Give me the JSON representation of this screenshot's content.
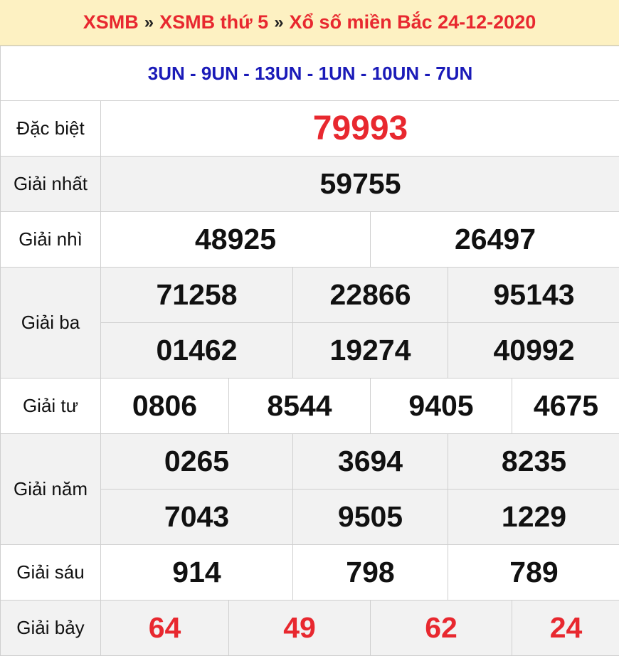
{
  "breadcrumb": {
    "item1": "XSMB",
    "sep1": "»",
    "item2": "XSMB thứ 5",
    "sep2": "»",
    "item3": "Xổ số miền Bắc 24-12-2020"
  },
  "codes": "3UN - 9UN - 13UN - 1UN - 10UN - 7UN",
  "prizes": {
    "dac_biet": {
      "label": "Đặc biệt",
      "numbers": [
        "79993"
      ]
    },
    "nhat": {
      "label": "Giải nhất",
      "numbers": [
        "59755"
      ]
    },
    "nhi": {
      "label": "Giải nhì",
      "numbers": [
        "48925",
        "26497"
      ]
    },
    "ba": {
      "label": "Giải ba",
      "numbers": [
        "71258",
        "22866",
        "95143",
        "01462",
        "19274",
        "40992"
      ]
    },
    "tu": {
      "label": "Giải tư",
      "numbers": [
        "0806",
        "8544",
        "9405",
        "4675"
      ]
    },
    "nam": {
      "label": "Giải năm",
      "numbers": [
        "0265",
        "3694",
        "8235",
        "7043",
        "9505",
        "1229"
      ]
    },
    "sau": {
      "label": "Giải sáu",
      "numbers": [
        "914",
        "798",
        "789"
      ]
    },
    "bay": {
      "label": "Giải bảy",
      "numbers": [
        "64",
        "49",
        "62",
        "24"
      ]
    }
  },
  "colors": {
    "accent_red": "#e8282f",
    "code_blue": "#1a1ab8",
    "header_bg": "#fdf1c2",
    "alt_row_bg": "#f2f2f2"
  }
}
